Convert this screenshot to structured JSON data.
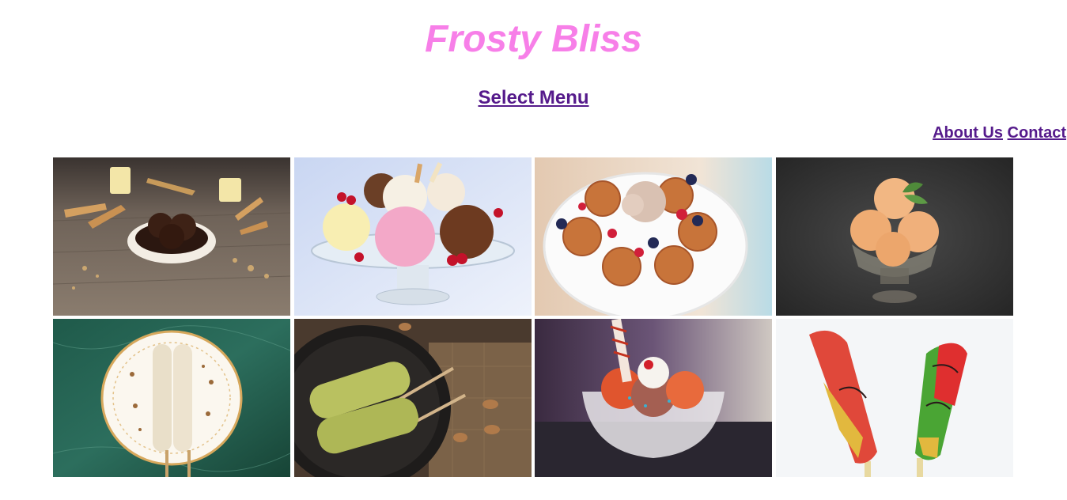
{
  "header": {
    "title": "Frosty Bliss",
    "title_color": "#f77fe8"
  },
  "nav": {
    "select_menu": "Select Menu",
    "about": "About Us",
    "contact": "Contact",
    "link_color": "#551a8b"
  },
  "gallery": {
    "items": [
      {
        "name": "chocolate-ice-cream-cones-photo"
      },
      {
        "name": "ice-cream-sundae-bowl-photo"
      },
      {
        "name": "waffle-ice-cream-plate-photo"
      },
      {
        "name": "orange-ice-cream-glass-photo"
      },
      {
        "name": "kulfi-plate-photo"
      },
      {
        "name": "pistachio-kulfi-photo"
      },
      {
        "name": "sundae-glass-photo"
      },
      {
        "name": "colorful-popsicles-photo"
      }
    ]
  }
}
